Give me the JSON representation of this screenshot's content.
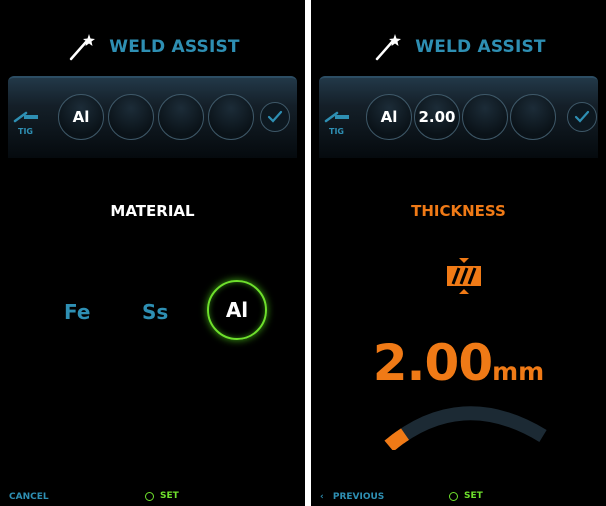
{
  "colors": {
    "accent_blue": "#2e8fb3",
    "accent_orange": "#f07a16",
    "accent_green": "#6ee02c",
    "background": "#000000"
  },
  "left": {
    "title": "WELD ASSIST",
    "process_label": "TIG",
    "slots": [
      "Al",
      "",
      "",
      ""
    ],
    "heading": "MATERIAL",
    "materials": [
      "Fe",
      "Ss",
      "Al"
    ],
    "selected_material": "Al",
    "cancel_label": "CANCEL",
    "set_label": "SET"
  },
  "right": {
    "title": "WELD ASSIST",
    "process_label": "TIG",
    "slots": [
      "Al",
      "2.00",
      "",
      ""
    ],
    "heading": "THICKNESS",
    "value": "2.00",
    "unit": "mm",
    "dial_fraction": 0.12,
    "previous_label": "PREVIOUS",
    "set_label": "SET"
  }
}
